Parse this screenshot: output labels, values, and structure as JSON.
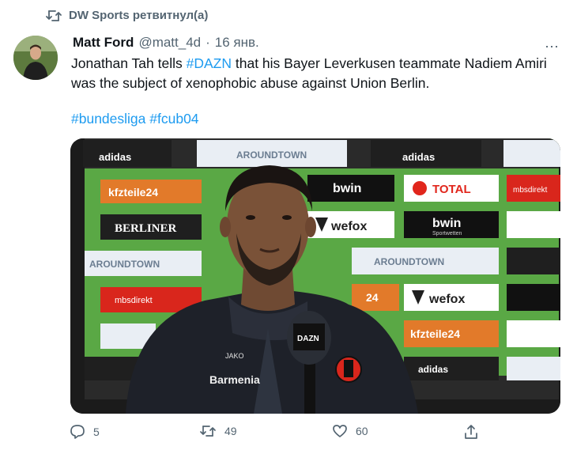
{
  "retweet": {
    "text": "DW Sports ретвитнул(а)"
  },
  "tweet": {
    "author_name": "Matt Ford",
    "handle": "@matt_4d",
    "separator": "·",
    "date": "16 янв.",
    "text_1": "Jonathan Tah tells ",
    "mention": "#DAZN",
    "text_2": " that his Bayer Leverkusen teammate Nadiem Amiri was the subject of xenophobic abuse against Union Berlin.",
    "hashtag_1": "#bundesliga",
    "hashtag_2": "#fcub04",
    "more_glyph": "⋯"
  },
  "media": {
    "boards": {
      "adidas": "adidas",
      "aroundtown": "AROUNDTOWN",
      "kfzteile": "kfzteile24",
      "bwin": "bwin",
      "bwin_sub": "Sportwetten",
      "total": "TOTAL",
      "mbs": "mbsdirekt",
      "berliner": "BERLINER",
      "wefox": "wefox",
      "num24": "24"
    },
    "jacket": {
      "brand": "JAKO",
      "sponsor": "Barmenia"
    },
    "mic_label": "DAZN"
  },
  "actions": {
    "replies": "5",
    "retweets": "49",
    "likes": "60"
  },
  "colors": {
    "link": "#1d9bf0",
    "muted": "#536471",
    "text": "#0f1419",
    "board_green": "#5aa845",
    "kfz_orange": "#e27a2a",
    "santander_red": "#d9261c"
  }
}
